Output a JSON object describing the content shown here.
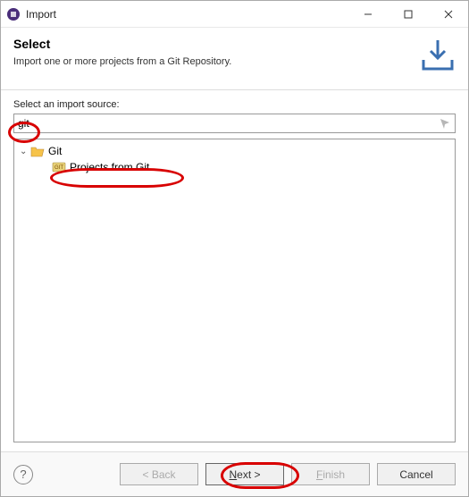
{
  "window": {
    "title": "Import"
  },
  "banner": {
    "title": "Select",
    "description": "Import one or more projects from a Git Repository."
  },
  "filter": {
    "label": "Select an import source:",
    "value": "git"
  },
  "tree": {
    "root": {
      "label": "Git"
    },
    "child": {
      "label": "Projects from Git"
    }
  },
  "buttons": {
    "back": "< Back",
    "next_prefix": "N",
    "next_rest": "ext >",
    "finish_prefix": "F",
    "finish_rest": "inish",
    "cancel": "Cancel",
    "help": "?"
  }
}
